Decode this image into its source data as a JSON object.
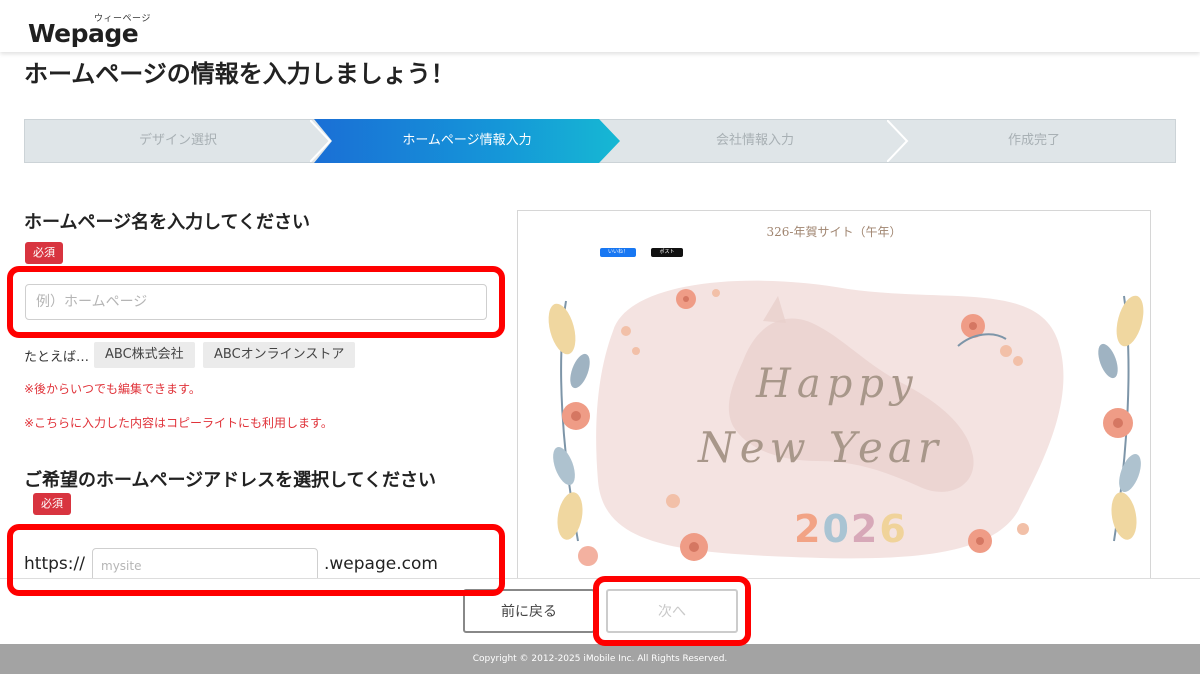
{
  "header": {
    "logo_kana": "ウィーページ",
    "logo_text": "Wepage"
  },
  "page": {
    "title": "ホームページの情報を入力しましょう！"
  },
  "steps": [
    {
      "label": "デザイン選択",
      "state": "done"
    },
    {
      "label": "ホームページ情報入力",
      "state": "active"
    },
    {
      "label": "会社情報入力",
      "state": "pending"
    },
    {
      "label": "作成完了",
      "state": "pending"
    }
  ],
  "site_name": {
    "label": "ホームページ名を入力してください",
    "required_badge": "必須",
    "value": "",
    "placeholder": "例）ホームページ",
    "examples_prefix": "たとえば…",
    "examples": [
      "ABC株式会社",
      "ABCオンラインストア"
    ],
    "notes": [
      "※後からいつでも編集できます。",
      "※こちらに入力した内容はコピーライトにも利用します。"
    ]
  },
  "site_address": {
    "label": "ご希望のホームページアドレスを選択してください",
    "required_badge": "必須",
    "prefix": "https://",
    "value": "",
    "placeholder": "mysite",
    "suffix": ".wepage.com"
  },
  "preview": {
    "title": "326-年賀サイト（午年）",
    "share_buttons": [
      "いいね！",
      "ポスト"
    ],
    "script_line1": "Happy",
    "script_line2": "New Year",
    "year": "2026",
    "year_colors": [
      "#f2a385",
      "#a9c4d3",
      "#d7a8b8",
      "#f0d39a"
    ]
  },
  "actions": {
    "back_label": "前に戻る",
    "next_label": "次へ"
  },
  "footer": {
    "copyright": "Copyright © 2012-2025 iMobile Inc. All Rights Reserved."
  },
  "colors": {
    "accent_start": "#1a6fd6",
    "accent_end": "#16b8d3",
    "required": "#d8343f",
    "highlight": "#ff0000",
    "note": "#e0333a"
  }
}
